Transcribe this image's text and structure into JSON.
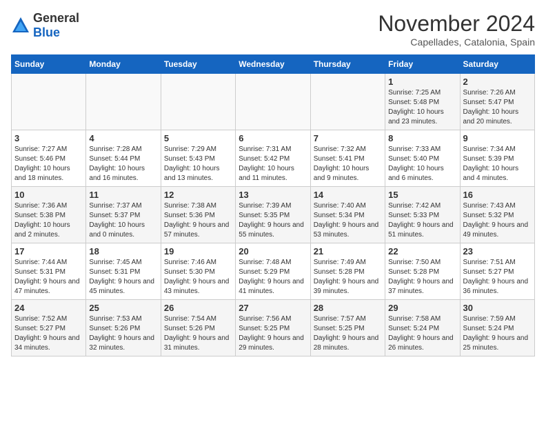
{
  "header": {
    "logo_general": "General",
    "logo_blue": "Blue",
    "month_title": "November 2024",
    "subtitle": "Capellades, Catalonia, Spain"
  },
  "days_of_week": [
    "Sunday",
    "Monday",
    "Tuesday",
    "Wednesday",
    "Thursday",
    "Friday",
    "Saturday"
  ],
  "weeks": [
    [
      {
        "day": "",
        "info": ""
      },
      {
        "day": "",
        "info": ""
      },
      {
        "day": "",
        "info": ""
      },
      {
        "day": "",
        "info": ""
      },
      {
        "day": "",
        "info": ""
      },
      {
        "day": "1",
        "info": "Sunrise: 7:25 AM\nSunset: 5:48 PM\nDaylight: 10 hours and 23 minutes."
      },
      {
        "day": "2",
        "info": "Sunrise: 7:26 AM\nSunset: 5:47 PM\nDaylight: 10 hours and 20 minutes."
      }
    ],
    [
      {
        "day": "3",
        "info": "Sunrise: 7:27 AM\nSunset: 5:46 PM\nDaylight: 10 hours and 18 minutes."
      },
      {
        "day": "4",
        "info": "Sunrise: 7:28 AM\nSunset: 5:44 PM\nDaylight: 10 hours and 16 minutes."
      },
      {
        "day": "5",
        "info": "Sunrise: 7:29 AM\nSunset: 5:43 PM\nDaylight: 10 hours and 13 minutes."
      },
      {
        "day": "6",
        "info": "Sunrise: 7:31 AM\nSunset: 5:42 PM\nDaylight: 10 hours and 11 minutes."
      },
      {
        "day": "7",
        "info": "Sunrise: 7:32 AM\nSunset: 5:41 PM\nDaylight: 10 hours and 9 minutes."
      },
      {
        "day": "8",
        "info": "Sunrise: 7:33 AM\nSunset: 5:40 PM\nDaylight: 10 hours and 6 minutes."
      },
      {
        "day": "9",
        "info": "Sunrise: 7:34 AM\nSunset: 5:39 PM\nDaylight: 10 hours and 4 minutes."
      }
    ],
    [
      {
        "day": "10",
        "info": "Sunrise: 7:36 AM\nSunset: 5:38 PM\nDaylight: 10 hours and 2 minutes."
      },
      {
        "day": "11",
        "info": "Sunrise: 7:37 AM\nSunset: 5:37 PM\nDaylight: 10 hours and 0 minutes."
      },
      {
        "day": "12",
        "info": "Sunrise: 7:38 AM\nSunset: 5:36 PM\nDaylight: 9 hours and 57 minutes."
      },
      {
        "day": "13",
        "info": "Sunrise: 7:39 AM\nSunset: 5:35 PM\nDaylight: 9 hours and 55 minutes."
      },
      {
        "day": "14",
        "info": "Sunrise: 7:40 AM\nSunset: 5:34 PM\nDaylight: 9 hours and 53 minutes."
      },
      {
        "day": "15",
        "info": "Sunrise: 7:42 AM\nSunset: 5:33 PM\nDaylight: 9 hours and 51 minutes."
      },
      {
        "day": "16",
        "info": "Sunrise: 7:43 AM\nSunset: 5:32 PM\nDaylight: 9 hours and 49 minutes."
      }
    ],
    [
      {
        "day": "17",
        "info": "Sunrise: 7:44 AM\nSunset: 5:31 PM\nDaylight: 9 hours and 47 minutes."
      },
      {
        "day": "18",
        "info": "Sunrise: 7:45 AM\nSunset: 5:31 PM\nDaylight: 9 hours and 45 minutes."
      },
      {
        "day": "19",
        "info": "Sunrise: 7:46 AM\nSunset: 5:30 PM\nDaylight: 9 hours and 43 minutes."
      },
      {
        "day": "20",
        "info": "Sunrise: 7:48 AM\nSunset: 5:29 PM\nDaylight: 9 hours and 41 minutes."
      },
      {
        "day": "21",
        "info": "Sunrise: 7:49 AM\nSunset: 5:28 PM\nDaylight: 9 hours and 39 minutes."
      },
      {
        "day": "22",
        "info": "Sunrise: 7:50 AM\nSunset: 5:28 PM\nDaylight: 9 hours and 37 minutes."
      },
      {
        "day": "23",
        "info": "Sunrise: 7:51 AM\nSunset: 5:27 PM\nDaylight: 9 hours and 36 minutes."
      }
    ],
    [
      {
        "day": "24",
        "info": "Sunrise: 7:52 AM\nSunset: 5:27 PM\nDaylight: 9 hours and 34 minutes."
      },
      {
        "day": "25",
        "info": "Sunrise: 7:53 AM\nSunset: 5:26 PM\nDaylight: 9 hours and 32 minutes."
      },
      {
        "day": "26",
        "info": "Sunrise: 7:54 AM\nSunset: 5:26 PM\nDaylight: 9 hours and 31 minutes."
      },
      {
        "day": "27",
        "info": "Sunrise: 7:56 AM\nSunset: 5:25 PM\nDaylight: 9 hours and 29 minutes."
      },
      {
        "day": "28",
        "info": "Sunrise: 7:57 AM\nSunset: 5:25 PM\nDaylight: 9 hours and 28 minutes."
      },
      {
        "day": "29",
        "info": "Sunrise: 7:58 AM\nSunset: 5:24 PM\nDaylight: 9 hours and 26 minutes."
      },
      {
        "day": "30",
        "info": "Sunrise: 7:59 AM\nSunset: 5:24 PM\nDaylight: 9 hours and 25 minutes."
      }
    ]
  ]
}
